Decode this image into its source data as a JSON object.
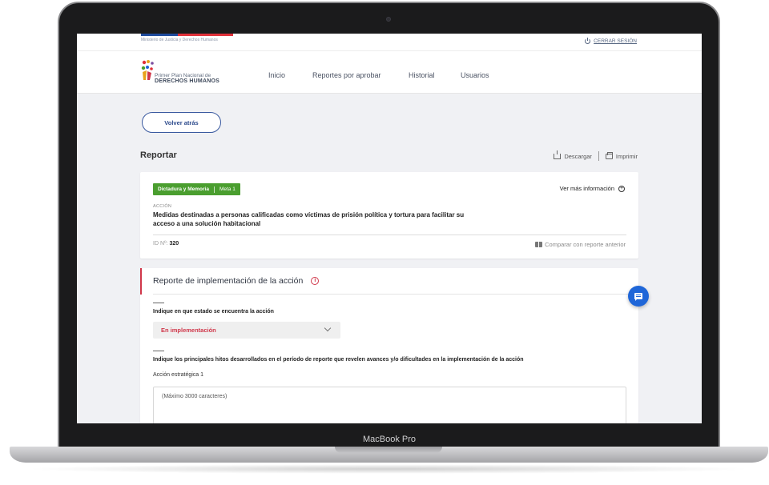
{
  "device": {
    "label": "MacBook Pro"
  },
  "header": {
    "ministry": "Ministerio de Justicia y Derechos Humanos",
    "logout": "CERRAR SESIÓN"
  },
  "logo": {
    "line1": "Primer Plan Nacional de",
    "line2": "DERECHOS HUMANOS"
  },
  "nav": [
    {
      "label": "Inicio"
    },
    {
      "label": "Reportes por aprobar"
    },
    {
      "label": "Historial"
    },
    {
      "label": "Usuarios"
    }
  ],
  "back_button": "Volver atrás",
  "page": {
    "title": "Reportar",
    "download": "Descargar",
    "print": "Imprimir"
  },
  "action_card": {
    "tag_category": "Dictadura y Memoria",
    "tag_goal": "Meta 1",
    "more_info": "Ver más información",
    "accion_label": "ACCIÓN",
    "accion_text": "Medidas destinadas a personas calificadas como víctimas de prisión política y tortura para facilitar su acceso a una solución habitacional",
    "id_label": "ID Nº:",
    "id_value": "320",
    "compare": "Comparar con reporte anterior"
  },
  "report": {
    "title": "Reporte de implementación de la acción",
    "q1": "Indique en que estado se encuentra la acción",
    "status_value": "En implementación",
    "q2": "Indique los principales hitos desarrollados en el período de reporte que revelen avances y/o dificultades en la implementación de la acción",
    "sub_label": "Acción estratégica 1",
    "textarea_placeholder": "(Máximo 3000 caracteres)"
  },
  "colors": {
    "accent_blue": "#1f66d8",
    "tag_green": "#4a9e2f",
    "alert_red": "#d0374a",
    "primary_navy": "#2c4a8c"
  }
}
